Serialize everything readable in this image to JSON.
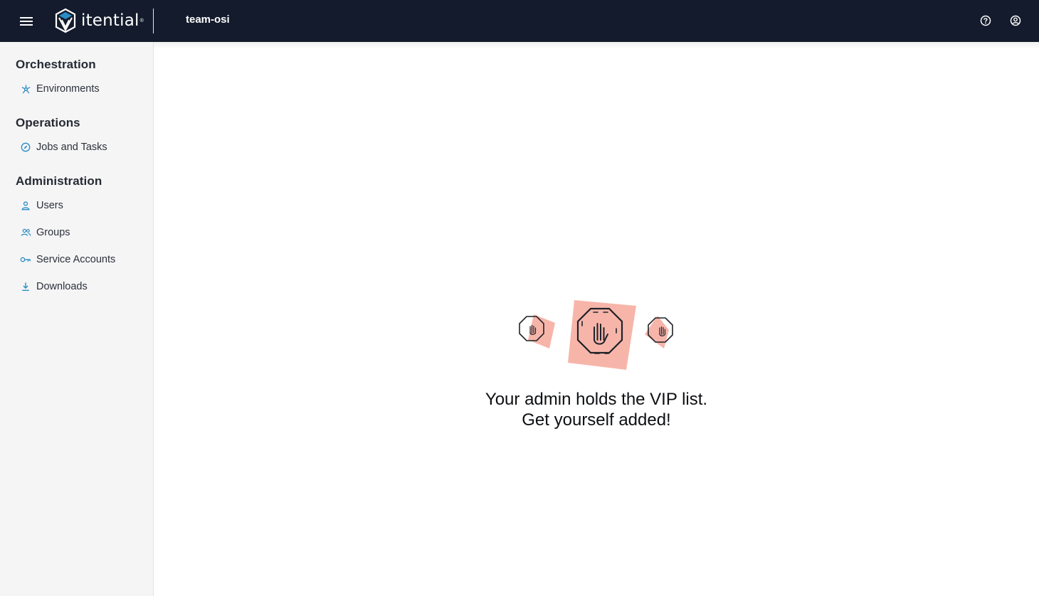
{
  "header": {
    "brand": "itential",
    "team": "team-osi"
  },
  "sidebar": {
    "sections": [
      {
        "title": "Orchestration",
        "items": [
          {
            "label": "Environments",
            "icon": "environments-icon"
          }
        ]
      },
      {
        "title": "Operations",
        "items": [
          {
            "label": "Jobs and Tasks",
            "icon": "compass-icon"
          }
        ]
      },
      {
        "title": "Administration",
        "items": [
          {
            "label": "Users",
            "icon": "user-icon"
          },
          {
            "label": "Groups",
            "icon": "group-icon"
          },
          {
            "label": "Service Accounts",
            "icon": "key-icon"
          },
          {
            "label": "Downloads",
            "icon": "download-icon"
          }
        ]
      }
    ]
  },
  "main": {
    "message_line1": "Your admin holds the VIP list.",
    "message_line2": "Get yourself added!"
  },
  "colors": {
    "topbar_bg": "#131b2c",
    "sidebar_bg": "#f5f5f6",
    "accent_blue": "#2a8cc4",
    "stop_fill": "#f7b5aa"
  }
}
